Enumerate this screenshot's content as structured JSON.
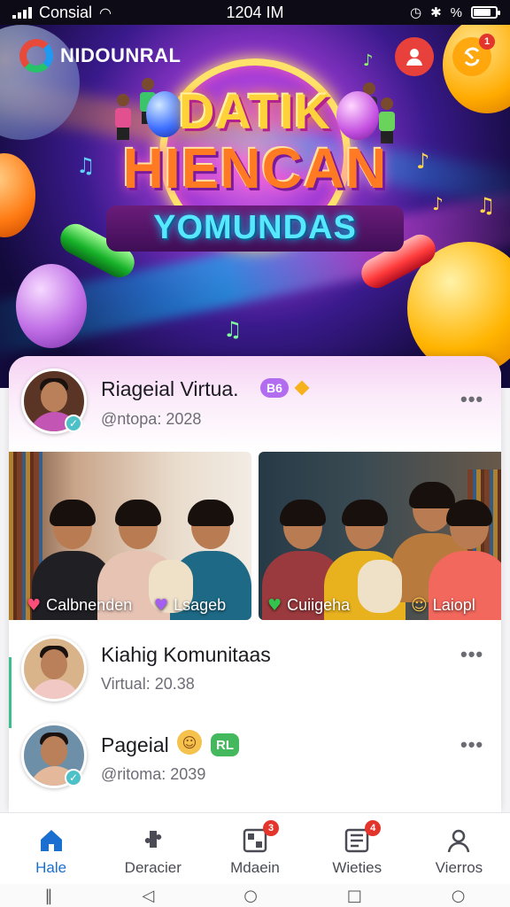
{
  "status_bar": {
    "carrier": "Consial",
    "time": "1204 IM",
    "right_text": "%"
  },
  "header": {
    "app_name": "NIDOUNRAL",
    "notification_count": "1"
  },
  "banner": {
    "title_line1": "DATIK",
    "title_line2": "HIENCAN",
    "title_line3": "YOMUNDAS"
  },
  "featured_post": {
    "title": "Riageial Virtua.",
    "level_badge": "B6",
    "subtitle": "@ntopa: 2028",
    "more": "•••"
  },
  "photos": [
    {
      "tags": [
        {
          "icon": "heart-icon",
          "glyph": "♥",
          "color": "#ff4d7a",
          "label": "Calbnenden"
        },
        {
          "icon": "heart-icon",
          "glyph": "♥",
          "color": "#a65ef0",
          "label": "Lsageb"
        }
      ]
    },
    {
      "tags": [
        {
          "icon": "heart-icon",
          "glyph": "♥",
          "color": "#33c24d",
          "label": "Cuiigeha"
        },
        {
          "icon": "smiley-icon",
          "glyph": "☺",
          "color": "#f4c24d",
          "label": "Laiopl"
        }
      ]
    }
  ],
  "list_items": [
    {
      "title": "Kiahig Komunitaas",
      "subtitle": "Virtual: 20.38",
      "more": "•••"
    },
    {
      "title": "Pageial",
      "chip": "RL",
      "subtitle": "@ritoma: 2039",
      "more": "•••"
    }
  ],
  "bottom_nav": [
    {
      "label": "Hale",
      "icon": "home-icon",
      "active": true
    },
    {
      "label": "Deracier",
      "icon": "puzzle-icon",
      "active": false
    },
    {
      "label": "Mdaein",
      "icon": "grid-icon",
      "badge": "3",
      "active": false
    },
    {
      "label": "Wieties",
      "icon": "document-icon",
      "badge": "4",
      "active": false
    },
    {
      "label": "Vierros",
      "icon": "person-icon",
      "active": false
    }
  ],
  "colors": {
    "accent": "#1a6fd0",
    "badge": "#e4352c",
    "profile_button": "#e8403a"
  }
}
